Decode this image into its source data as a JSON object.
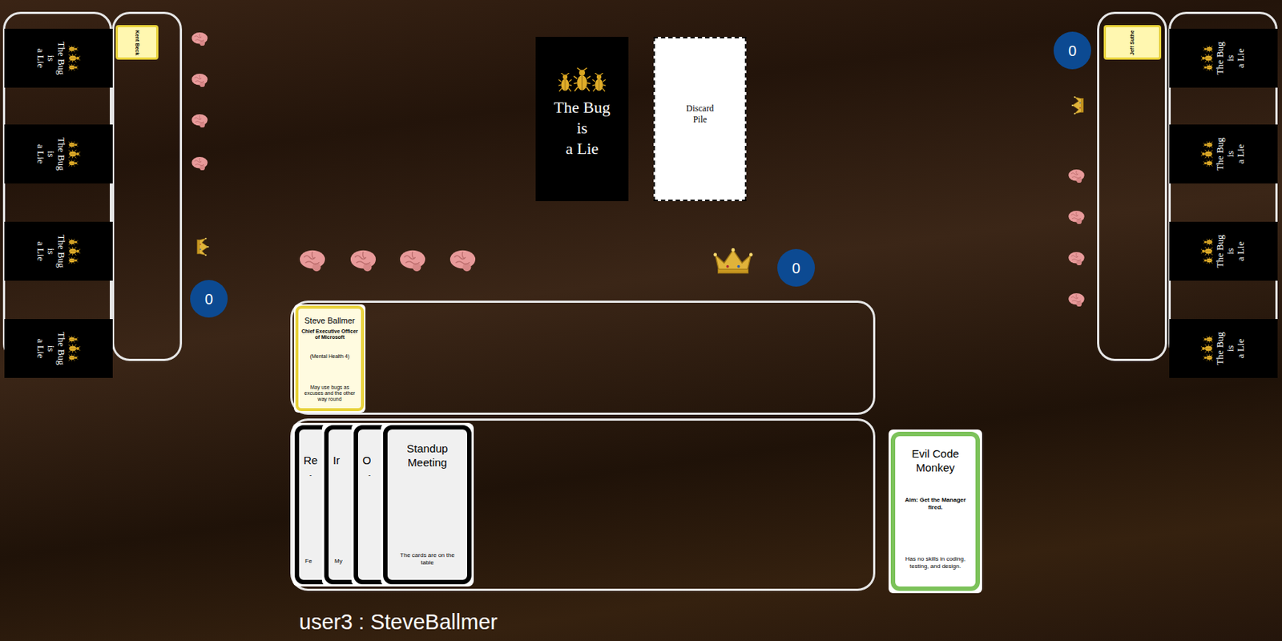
{
  "table": {
    "deck": {
      "lines": [
        "The Bug",
        "is",
        "a Lie"
      ]
    },
    "discard": {
      "lines": [
        "Discard",
        "Pile"
      ]
    }
  },
  "opponents": [
    {
      "side": "left",
      "score": "0",
      "brains": 4,
      "crown": true,
      "card_backs": 4,
      "character": "Kent Beck"
    },
    {
      "side": "right",
      "score": "0",
      "brains": 4,
      "crown": true,
      "card_backs": 4,
      "character": "Jeff Suthe"
    }
  ],
  "player": {
    "label": "user3 : SteveBallmer",
    "score": "0",
    "brains": 4,
    "crown": true,
    "character": {
      "name": "Steve Ballmer",
      "title": "Chief Executive Officer of Microsoft",
      "mental_health": "(Mental Health 4)",
      "ability": "May use bugs as excuses and the other way round"
    },
    "hand": [
      {
        "kind": "covered",
        "title": "Re",
        "middle": "-",
        "bottom": "Fe"
      },
      {
        "kind": "covered",
        "title": "Ir",
        "bottom": "My"
      },
      {
        "kind": "covered",
        "title": "O",
        "middle": "-"
      },
      {
        "kind": "top",
        "title": "Standup Meeting",
        "bottom": "The cards are on the table"
      }
    ],
    "role": {
      "name": "Evil Code Monkey",
      "aim": "Aim: Get the Manager fired.",
      "description": "Has no skills in coding, testing, and design."
    }
  }
}
